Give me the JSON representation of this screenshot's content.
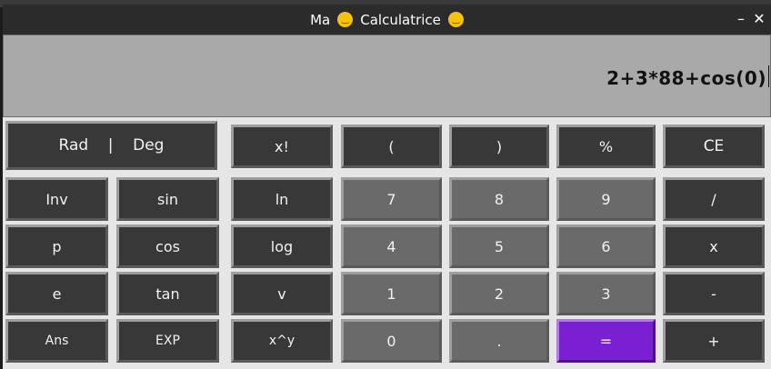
{
  "window": {
    "title_left": "Ma",
    "title_emoji_1": "😁",
    "title_main": "Calculatrice",
    "title_emoji_2": "😃",
    "minimize": "–",
    "close": "✕"
  },
  "display": {
    "expression": "2+3*88+cos(0)"
  },
  "keys": {
    "rad_deg": "Rad    |    Deg",
    "fact": "x!",
    "lparen": "(",
    "rparen": ")",
    "percent": "%",
    "ce": "CE",
    "inv": "Inv",
    "sin": "sin",
    "ln": "ln",
    "n7": "7",
    "n8": "8",
    "n9": "9",
    "div": "/",
    "pi": "p",
    "cos": "cos",
    "log": "log",
    "n4": "4",
    "n5": "5",
    "n6": "6",
    "mul": "x",
    "e": "e",
    "tan": "tan",
    "sqrt": "v",
    "n1": "1",
    "n2": "2",
    "n3": "3",
    "sub": "-",
    "ans": "Ans",
    "exp": "EXP",
    "pow": "x^y",
    "n0": "0",
    "dot": ".",
    "eq": "=",
    "add": "+"
  },
  "colors": {
    "equals_button": "#7a1fd1",
    "display_bg": "#a9a9a9",
    "key_dark": "#383838",
    "key_number": "#6a6a6a"
  }
}
